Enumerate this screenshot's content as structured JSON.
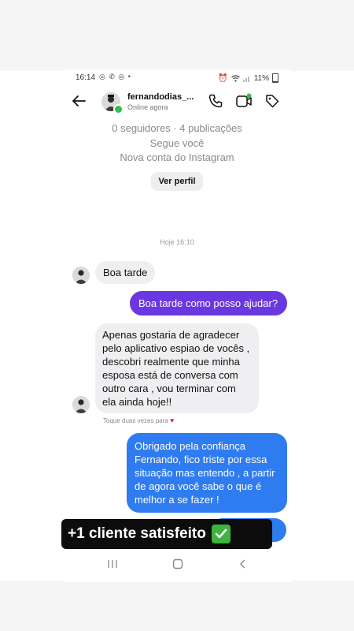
{
  "status_bar": {
    "time": "16:14",
    "app_icons": "◎ ✆ ◎ •",
    "battery": "11%"
  },
  "header": {
    "username": "fernandodias_...",
    "status": "Online agora",
    "online_color": "#2fbf4a"
  },
  "profile": {
    "followers": "0 seguidores · 4 publicações",
    "follows_you": "Segue você",
    "new_account": "Nova conta do Instagram",
    "view_profile": "Ver perfil"
  },
  "date_separator": "Hoje 16:10",
  "messages": [
    {
      "from": "them",
      "text": "Boa tarde"
    },
    {
      "from": "me",
      "text": "Boa tarde como posso ajudar?"
    },
    {
      "from": "them",
      "text": "Apenas gostaria de agradecer pelo aplicativo espiao de vocês , descobri realmente que minha esposa está de conversa com outro cara , vou terminar com ela ainda hoje!!"
    },
    {
      "from": "me",
      "text": "Obrigado pela confiança Fernando, fico triste por essa situação mas entendo , a partir de agora você sabe o que é melhor a se fazer !"
    }
  ],
  "hint": "Toque duas vezes para",
  "banner": {
    "text": "+1 cliente satisfeito",
    "check": "✔"
  },
  "colors": {
    "purple_bubble": "#6a38e0",
    "blue_bubble": "#2f7cf0",
    "received_bubble": "#efeff1",
    "banner_bg": "#0c0c0c"
  },
  "icons": [
    "arrow-back-icon",
    "phone-icon",
    "video-icon",
    "tag-icon",
    "heart-icon",
    "check-icon",
    "recent-apps-icon",
    "home-icon",
    "nav-back-icon"
  ]
}
